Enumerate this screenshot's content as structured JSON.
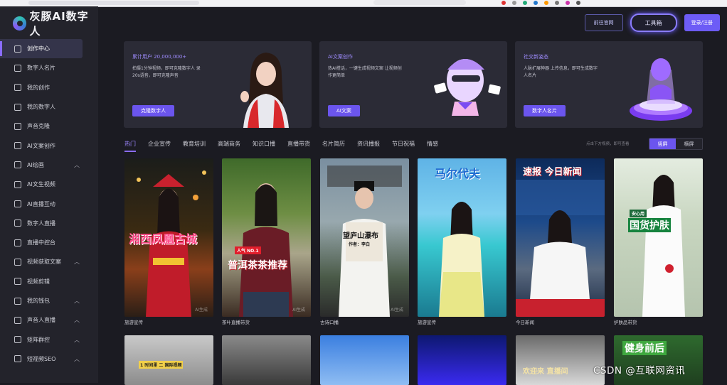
{
  "brand": {
    "name": "灰豚AI数字人"
  },
  "top_buttons": {
    "official": "前往官网",
    "workbench": "工具箱",
    "login": "登录/注册"
  },
  "sidebar": {
    "items": [
      {
        "label": "创作中心",
        "icon": "layers-icon",
        "active": true
      },
      {
        "label": "数字人名片",
        "icon": "id-card-icon"
      },
      {
        "label": "我的创作",
        "icon": "play-square-icon"
      },
      {
        "label": "我的数字人",
        "icon": "user-square-icon"
      },
      {
        "label": "声音克隆",
        "icon": "sound-wave-icon"
      },
      {
        "label": "AI文案创作",
        "icon": "edit-icon"
      },
      {
        "label": "AI绘画",
        "icon": "palette-icon",
        "chevron": "︿"
      },
      {
        "label": "AI文生视频",
        "icon": "video-icon"
      },
      {
        "label": "AI直播互动",
        "icon": "chat-icon"
      },
      {
        "label": "数字人直播",
        "icon": "broadcast-icon"
      },
      {
        "label": "直播中控台",
        "icon": "monitor-icon"
      },
      {
        "label": "视频获取文案",
        "icon": "text-icon",
        "chevron": "︿"
      },
      {
        "label": "视频剪辑",
        "icon": "scissors-icon"
      },
      {
        "label": "我的钱包",
        "icon": "wallet-icon",
        "chevron": "︿"
      },
      {
        "label": "声音人直播",
        "icon": "mic-icon",
        "chevron": "︿"
      },
      {
        "label": "矩阵群控",
        "icon": "network-icon",
        "chevron": "︿"
      },
      {
        "label": "短视频SEO",
        "icon": "fire-icon",
        "chevron": "︿"
      }
    ]
  },
  "cards": [
    {
      "title": "累计用户 20,000,000+",
      "desc": "拍摄1分钟视频，即可克隆数字人 录20s语音，即可克隆声音",
      "button": "克隆数字人"
    },
    {
      "title": "AI文案创作",
      "desc": "热AI搭话，一键生成视频文案 让视频创作更简单",
      "button": "AI文案"
    },
    {
      "title": "社交新姿态",
      "desc": "人脉扩展神器 上传信息，即可生成数字人名片",
      "button": "数字人名片"
    }
  ],
  "tabs": [
    "热门",
    "企业宣传",
    "教育培训",
    "高端商务",
    "知识口播",
    "直播带货",
    "名片简历",
    "资讯播报",
    "节日祝福",
    "情感"
  ],
  "hint": "点击下方视频，即可查看",
  "orientation": {
    "portrait": "竖屏",
    "landscape": "横屏"
  },
  "videos": [
    {
      "label": "旅游宣传",
      "overlay": "湘西凤凰古城",
      "watermark": "AI生成"
    },
    {
      "label": "茶叶直播带货",
      "overlay": "普洱茶茶推荐",
      "badge": "人气 NO.1",
      "watermark": "AI生成"
    },
    {
      "label": "古诗口播",
      "overlay": "望庐山瀑布",
      "sub": "作者：李白",
      "watermark": "AI生成"
    },
    {
      "label": "旅游宣传",
      "overlay": "马尔代夫",
      "watermark": ""
    },
    {
      "label": "今日新闻",
      "overlay": "速报 今日新闻",
      "watermark": ""
    },
    {
      "label": "护肤品带货",
      "overlay": "国货护肤",
      "badge": "安心用",
      "watermark": ""
    }
  ],
  "videos_row2": [
    {
      "overlay": "1 时间里 二 国际视频"
    },
    {
      "overlay": ""
    },
    {
      "overlay": ""
    },
    {
      "overlay": ""
    },
    {
      "overlay": "欢迎来 直播间"
    },
    {
      "overlay": "健身前后"
    }
  ],
  "footer_watermark": "CSDN @互联网资讯",
  "colors": {
    "accent": "#6d5cf6",
    "bg": "#1b1b22",
    "sidebar": "#23232b",
    "card": "#2b2b36"
  }
}
